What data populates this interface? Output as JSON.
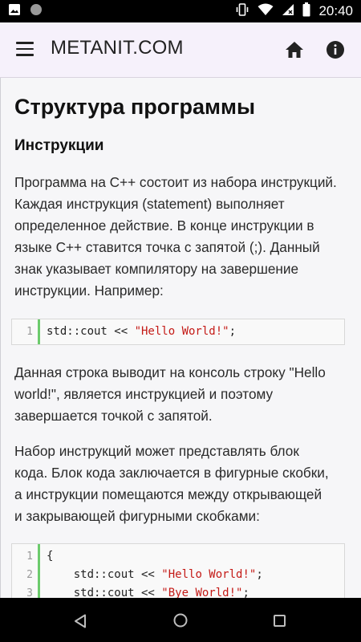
{
  "status_bar": {
    "time": "20:40",
    "icons": [
      "image-icon",
      "circle-icon",
      "vibrate-icon",
      "wifi-icon",
      "signal-off-icon",
      "battery-icon"
    ]
  },
  "app_bar": {
    "title": "METANIT.COM",
    "icons": [
      "menu-icon",
      "home-icon",
      "info-icon"
    ]
  },
  "article": {
    "title": "Структура программы",
    "section_title": "Инструкции",
    "paragraphs": [
      [
        "Программа на C++ состоит из набора инструкций.",
        "Каждая инструкция (statement) выполняет",
        "определенное действие. В конце инструкции в",
        "языке C++ ставится точка с запятой (;). Данный",
        "знак указывает компилятору на завершение",
        "инструкции. Например:"
      ],
      [
        "Данная строка выводит на консоль строку \"Hello",
        "world!\", является инструкцией и поэтому",
        "завершается точкой с запятой."
      ],
      [
        "Набор инструкций может представлять блок",
        "кода. Блок кода заключается в фигурные скобки,",
        "а инструкции помещаются между открывающей",
        "и закрывающей фигурными скобками:"
      ]
    ],
    "code_blocks": [
      {
        "lines": [
          {
            "num": "1",
            "code": "std::cout << ",
            "string": "\"Hello World!\"",
            "tail": ";"
          }
        ]
      },
      {
        "lines": [
          {
            "num": "1",
            "code": "{",
            "string": "",
            "tail": ""
          },
          {
            "num": "2",
            "code": "    std::cout << ",
            "string": "\"Hello World!\"",
            "tail": ";"
          },
          {
            "num": "3",
            "code": "    std::cout << ",
            "string": "\"Bye World!\"",
            "tail": ";"
          }
        ]
      }
    ]
  },
  "colors": {
    "app_bar_bg": "#f6f1fb",
    "content_bg": "#f6f6f8",
    "code_gutter_accent": "#6ccb6c",
    "code_string": "#c41a16"
  },
  "nav_bar": {
    "icons": [
      "back-icon",
      "home-circle-icon",
      "recent-apps-icon"
    ]
  }
}
